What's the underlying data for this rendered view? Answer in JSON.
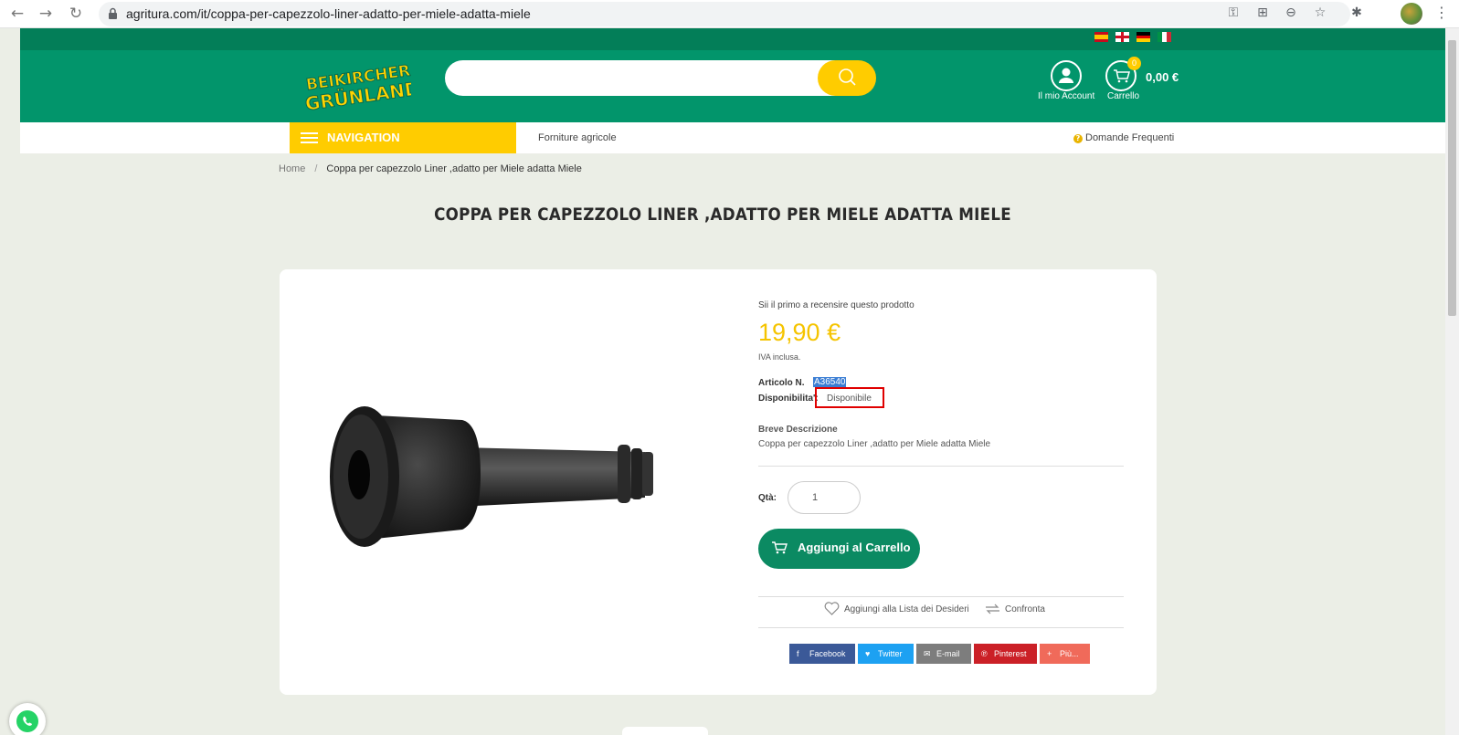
{
  "browser": {
    "url": "agritura.com/it/coppa-per-capezzolo-liner-adatto-per-miele-adatta-miele"
  },
  "header": {
    "account_label": "Il mio Account",
    "cart_label": "Carrello",
    "cart_count": "0",
    "cart_total": "0,00 €",
    "logo_text": "BEIKIRCHER GRÜNLAND",
    "languages": [
      "es",
      "en",
      "de",
      "it"
    ]
  },
  "nav": {
    "menu_label": "NAVIGATION",
    "link_forniture": "Forniture agricole",
    "link_faq": "Domande Frequenti"
  },
  "breadcrumb": {
    "home": "Home",
    "separator": "/",
    "current": "Coppa per capezzolo Liner ,adatto per Miele adatta Miele"
  },
  "product": {
    "title": "COPPA PER CAPEZZOLO LINER ,ADATTO PER MIELE ADATTA MIELE",
    "review_prompt": "Sii il primo a recensire questo prodotto",
    "price": "19,90 €",
    "vat_note": "IVA inclusa.",
    "sku_label": "Articolo N.",
    "sku": "A36540",
    "availability_label": "Disponibilita':",
    "availability": "Disponibile",
    "short_desc_title": "Breve Descrizione",
    "short_desc": "Coppa per capezzolo Liner ,adatto per Miele adatta Miele",
    "qty_label": "Qtà:",
    "qty_value": "1",
    "add_to_cart": "Aggiungi al Carrello",
    "wishlist": "Aggiungi alla Lista dei Desideri",
    "compare": "Confronta"
  },
  "share": {
    "facebook": "Facebook",
    "twitter": "Twitter",
    "email": "E-mail",
    "pinterest": "Pinterest",
    "more": "Più..."
  },
  "colors": {
    "brand_green": "#02956b",
    "dark_green": "#037e58",
    "accent_yellow": "#ffcc00",
    "price_yellow": "#f5c400",
    "button_green": "#0b8a62",
    "highlight_red": "#e00000"
  }
}
